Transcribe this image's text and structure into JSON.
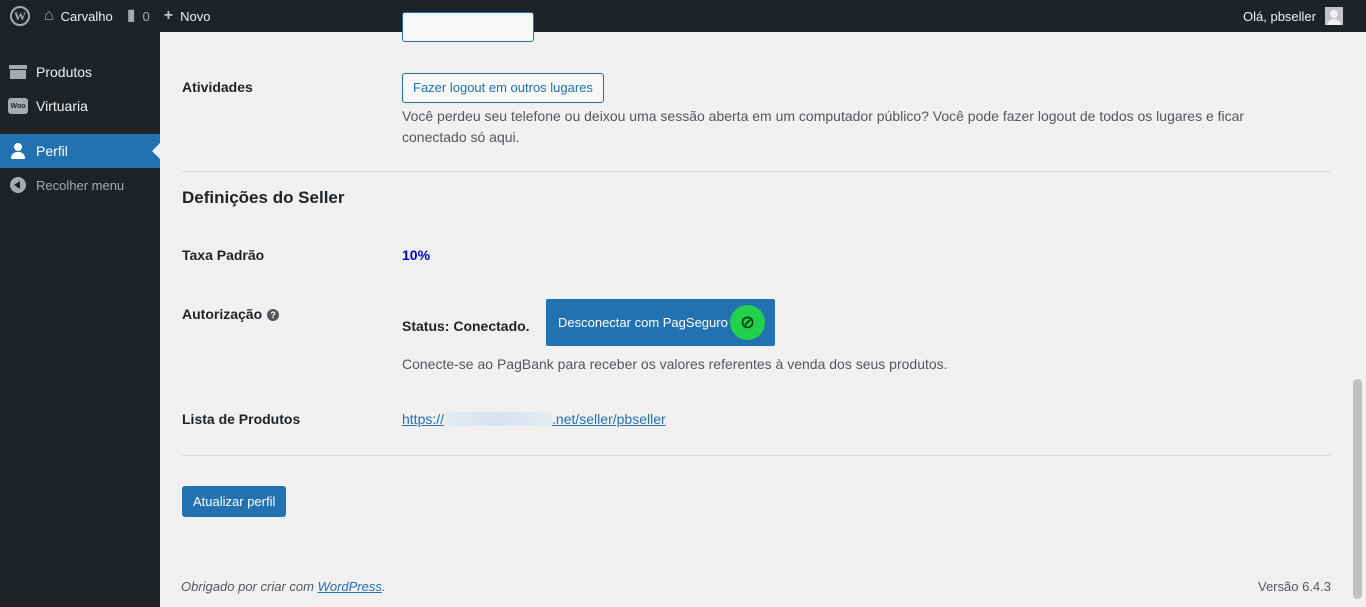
{
  "adminbar": {
    "site_name": "Carvalho",
    "comments_count": "0",
    "new_label": "Novo",
    "greeting": "Olá, pbseller"
  },
  "sidebar": {
    "items": [
      {
        "label": "Produtos",
        "icon": "archive-icon"
      },
      {
        "label": "Virtuaria",
        "icon": "woo-icon"
      },
      {
        "label": "Perfil",
        "icon": "user-icon",
        "current": true
      }
    ],
    "collapse_label": "Recolher menu"
  },
  "profile": {
    "activities_label": "Atividades",
    "logout_button": "Fazer logout em outros lugares",
    "logout_desc_line1": "Você perdeu seu telefone ou deixou uma sessão aberta em um computador público? Você pode fazer logout de todos os lugares e ficar",
    "logout_desc_line2": "conectado só aqui.",
    "seller_section_title": "Definições do Seller",
    "taxa_label": "Taxa Padrão",
    "taxa_value": "10%",
    "auth_label": "Autorização",
    "auth_help": "?",
    "auth_status": "Status: Conectado.",
    "disconnect_button": "Desconectar com PagSeguro",
    "auth_desc": "Conecte-se ao PagBank para receber os valores referentes à venda dos seus produtos.",
    "products_list_label": "Lista de Produtos",
    "products_link_prefix": "https://",
    "products_link_suffix": ".net/seller/pbseller",
    "update_button": "Atualizar perfil"
  },
  "footer": {
    "thanks_text": "Obrigado por criar com ",
    "wp_link": "WordPress",
    "thanks_end": ".",
    "version": "Versão 6.4.3"
  },
  "colors": {
    "admin_bar": "#1d2327",
    "accent": "#2271b1",
    "pagseguro_green": "#22d14a",
    "taxa_value": "#0000cc"
  }
}
